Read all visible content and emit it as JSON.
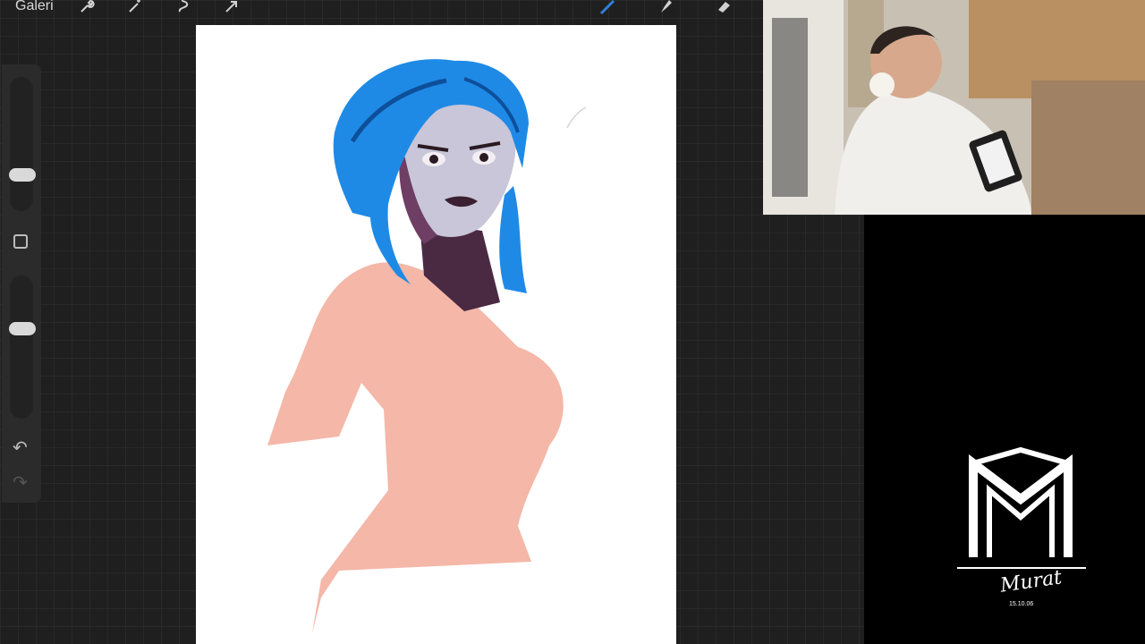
{
  "toolbar": {
    "gallery_label": "Galeri",
    "tools_left": [
      "wrench-icon",
      "magic-wand-icon",
      "selection-icon",
      "transform-arrow-icon"
    ],
    "tools_right": [
      "brush-icon",
      "smudge-icon",
      "eraser-icon"
    ],
    "active_color": "#2f7fd8"
  },
  "sidebar": {
    "undo_symbol": "↶",
    "redo_symbol": "↷"
  },
  "colors": {
    "hair": "#1f8ae6",
    "skin_shadow": "#4a2a42",
    "body": "#f4b7a8",
    "face": "#c8c6d8"
  },
  "logo": {
    "signature": "Murat",
    "date": "15.10.06"
  }
}
